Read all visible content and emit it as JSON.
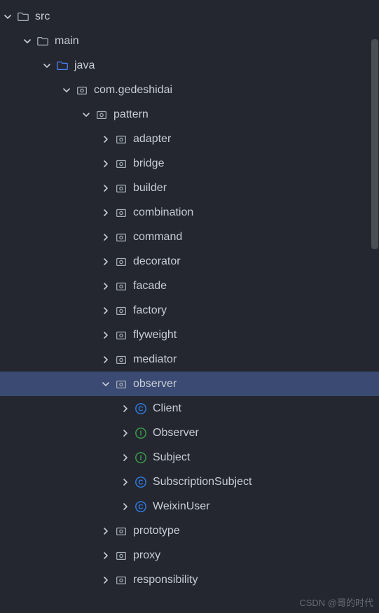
{
  "watermark": "CSDN @哥的时代",
  "colors": {
    "selectedBg": "#3a4a72",
    "folderBlue": "#4a86ff",
    "class": "#2f7ee6",
    "interface": "#3ea14b",
    "text": "#c8ccd4",
    "folder": "#a8afb8"
  },
  "tree": [
    {
      "indent": 0,
      "expanded": true,
      "iconType": "folder-open",
      "label": "src"
    },
    {
      "indent": 1,
      "expanded": true,
      "iconType": "folder-open",
      "label": "main"
    },
    {
      "indent": 2,
      "expanded": true,
      "iconType": "folder-open-blue",
      "label": "java"
    },
    {
      "indent": 3,
      "expanded": true,
      "iconType": "package",
      "label": "com.gedeshidai"
    },
    {
      "indent": 4,
      "expanded": true,
      "iconType": "package",
      "label": "pattern"
    },
    {
      "indent": 5,
      "expanded": false,
      "iconType": "package",
      "label": "adapter"
    },
    {
      "indent": 5,
      "expanded": false,
      "iconType": "package",
      "label": "bridge"
    },
    {
      "indent": 5,
      "expanded": false,
      "iconType": "package",
      "label": "builder"
    },
    {
      "indent": 5,
      "expanded": false,
      "iconType": "package",
      "label": "combination"
    },
    {
      "indent": 5,
      "expanded": false,
      "iconType": "package",
      "label": "command"
    },
    {
      "indent": 5,
      "expanded": false,
      "iconType": "package",
      "label": "decorator"
    },
    {
      "indent": 5,
      "expanded": false,
      "iconType": "package",
      "label": "facade"
    },
    {
      "indent": 5,
      "expanded": false,
      "iconType": "package",
      "label": "factory"
    },
    {
      "indent": 5,
      "expanded": false,
      "iconType": "package",
      "label": "flyweight"
    },
    {
      "indent": 5,
      "expanded": false,
      "iconType": "package",
      "label": "mediator"
    },
    {
      "indent": 5,
      "expanded": true,
      "iconType": "package",
      "label": "observer",
      "selected": true
    },
    {
      "indent": 6,
      "expanded": false,
      "iconType": "class",
      "label": "Client"
    },
    {
      "indent": 6,
      "expanded": false,
      "iconType": "interface",
      "label": "Observer"
    },
    {
      "indent": 6,
      "expanded": false,
      "iconType": "interface",
      "label": "Subject"
    },
    {
      "indent": 6,
      "expanded": false,
      "iconType": "class",
      "label": "SubscriptionSubject"
    },
    {
      "indent": 6,
      "expanded": false,
      "iconType": "class",
      "label": "WeixinUser"
    },
    {
      "indent": 5,
      "expanded": false,
      "iconType": "package",
      "label": "prototype"
    },
    {
      "indent": 5,
      "expanded": false,
      "iconType": "package",
      "label": "proxy"
    },
    {
      "indent": 5,
      "expanded": false,
      "iconType": "package",
      "label": "responsibility"
    }
  ]
}
